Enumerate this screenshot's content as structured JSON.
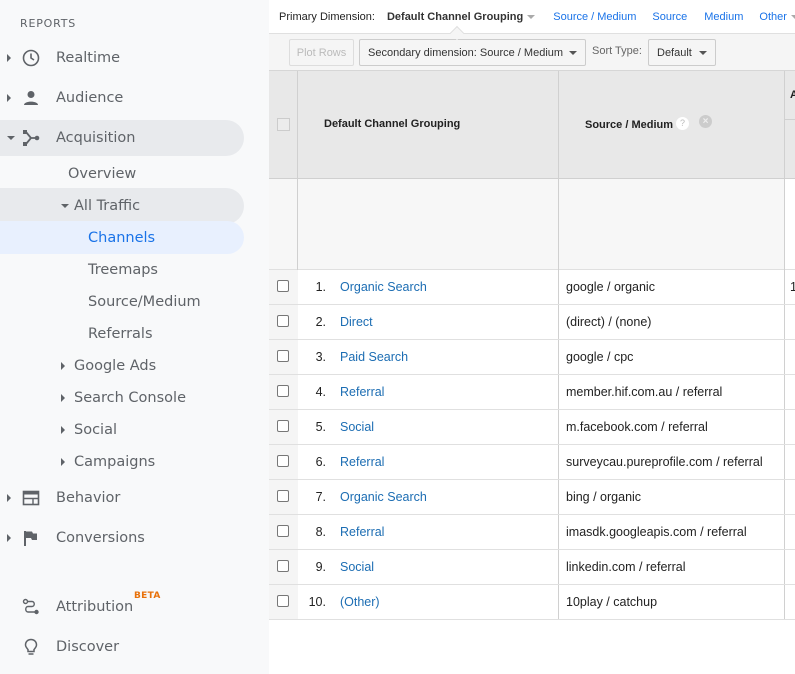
{
  "sidebar": {
    "section_label": "REPORTS",
    "items": [
      {
        "label": "Realtime",
        "icon": "clock-icon"
      },
      {
        "label": "Audience",
        "icon": "person-icon"
      },
      {
        "label": "Acquisition",
        "icon": "acquisition-icon"
      },
      {
        "label": "Overview"
      },
      {
        "label": "All Traffic"
      },
      {
        "label": "Channels"
      },
      {
        "label": "Treemaps"
      },
      {
        "label": "Source/Medium"
      },
      {
        "label": "Referrals"
      },
      {
        "label": "Google Ads"
      },
      {
        "label": "Search Console"
      },
      {
        "label": "Social"
      },
      {
        "label": "Campaigns"
      },
      {
        "label": "Behavior",
        "icon": "behavior-icon"
      },
      {
        "label": "Conversions",
        "icon": "flag-icon"
      },
      {
        "label": "Attribution",
        "icon": "attribution-icon",
        "badge": "BETA"
      },
      {
        "label": "Discover",
        "icon": "lightbulb-icon"
      }
    ],
    "colors": {
      "selected_text": "#1a73e8",
      "badge": "#e8710a"
    }
  },
  "dimension_bar": {
    "label": "Primary Dimension:",
    "current": "Default Channel Grouping",
    "links": [
      "Source / Medium",
      "Source",
      "Medium",
      "Other"
    ]
  },
  "toolbar": {
    "plot_rows": "Plot Rows",
    "secondary_dimension": "Secondary dimension: Source / Medium",
    "sort_label": "Sort Type:",
    "sort_value": "Default"
  },
  "table": {
    "headers": {
      "col1": "Default Channel Grouping",
      "col2": "Source / Medium",
      "help": "?",
      "remove": "×",
      "col3_truncated": "A"
    },
    "rows": [
      {
        "num": "1.",
        "channel": "Organic Search",
        "source_medium": "google / organic",
        "trunc": "1"
      },
      {
        "num": "2.",
        "channel": "Direct",
        "source_medium": "(direct) / (none)"
      },
      {
        "num": "3.",
        "channel": "Paid Search",
        "source_medium": "google / cpc"
      },
      {
        "num": "4.",
        "channel": "Referral",
        "source_medium": "member.hif.com.au / referral"
      },
      {
        "num": "5.",
        "channel": "Social",
        "source_medium": "m.facebook.com / referral"
      },
      {
        "num": "6.",
        "channel": "Referral",
        "source_medium": "surveycau.pureprofile.com / referral"
      },
      {
        "num": "7.",
        "channel": "Organic Search",
        "source_medium": "bing / organic"
      },
      {
        "num": "8.",
        "channel": "Referral",
        "source_medium": "imasdk.googleapis.com / referral"
      },
      {
        "num": "9.",
        "channel": "Social",
        "source_medium": "linkedin.com / referral"
      },
      {
        "num": "10.",
        "channel": "(Other)",
        "source_medium": "10play / catchup"
      }
    ]
  }
}
